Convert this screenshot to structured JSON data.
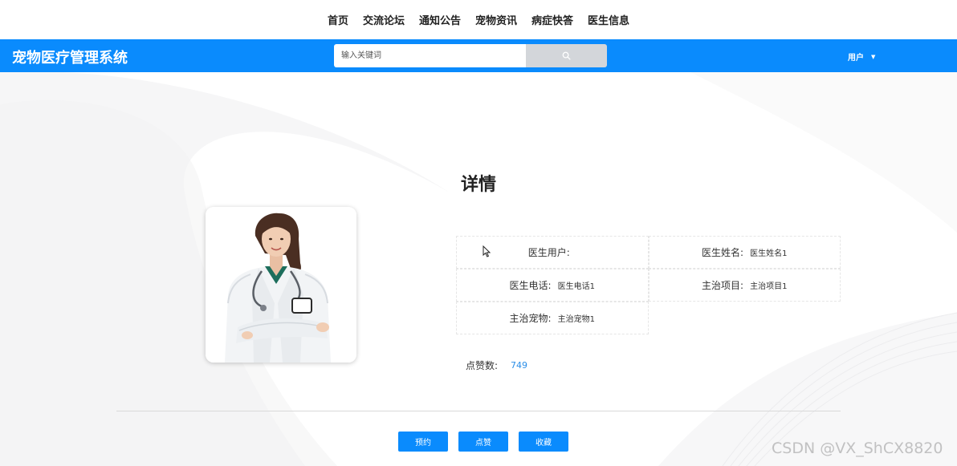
{
  "top_nav": {
    "items": [
      "首页",
      "交流论坛",
      "通知公告",
      "宠物资讯",
      "病症快答",
      "医生信息"
    ]
  },
  "header": {
    "brand": "宠物医疗管理系统",
    "search": {
      "placeholder": "输入关键词",
      "value": ""
    },
    "user_menu_label": "用户"
  },
  "detail": {
    "title": "详情",
    "fields": {
      "doctor_user": {
        "label": "医生用户:",
        "value": ""
      },
      "doctor_name": {
        "label": "医生姓名:",
        "value": "医生姓名1"
      },
      "doctor_phone": {
        "label": "医生电话:",
        "value": "医生电话1"
      },
      "main_project": {
        "label": "主治项目:",
        "value": "主治项目1"
      },
      "main_pet": {
        "label": "主治宠物:",
        "value": "主治宠物1"
      }
    },
    "likes": {
      "label": "点赞数:",
      "value": "749"
    }
  },
  "actions": {
    "book": "预约",
    "like": "点赞",
    "favorite": "收藏"
  },
  "watermark": "CSDN @VX_ShCX8820",
  "colors": {
    "primary": "#0a8bfd",
    "search_button": "#d3d6da",
    "link_value": "#2a8ee8"
  },
  "icons": {
    "search_button": "search-icon",
    "user_menu": "caret-down-icon"
  }
}
